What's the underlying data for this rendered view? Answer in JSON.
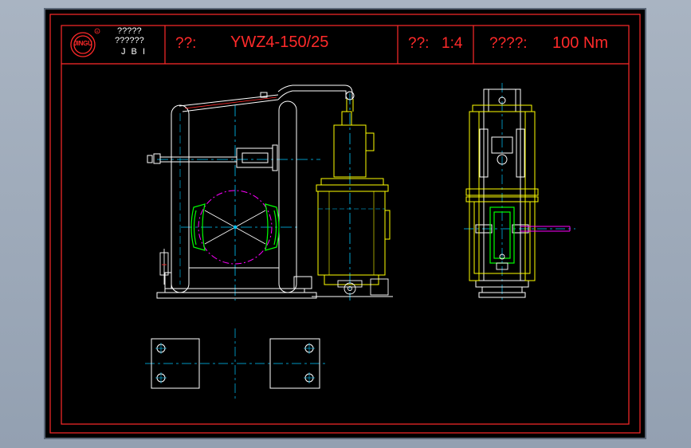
{
  "title_block": {
    "company_line1": "?????",
    "company_line2": "??????",
    "company_abbr": "J B I",
    "logo_text": "JINGU",
    "model_label": "??:",
    "model_value": "YWZ4-150/25",
    "scale_label": "??:",
    "scale_value": "1:4",
    "torque_label": "????:",
    "torque_value": "100 Nm"
  },
  "colors": {
    "background": "#000000",
    "frame": "#ff2a2a",
    "outline": "#ffffff",
    "centerline": "#00c8ff",
    "thruster": "#ffff00",
    "brake_shoe": "#00ff00",
    "wheel": "#ff00ff",
    "title_text": "#ff2a2a"
  }
}
